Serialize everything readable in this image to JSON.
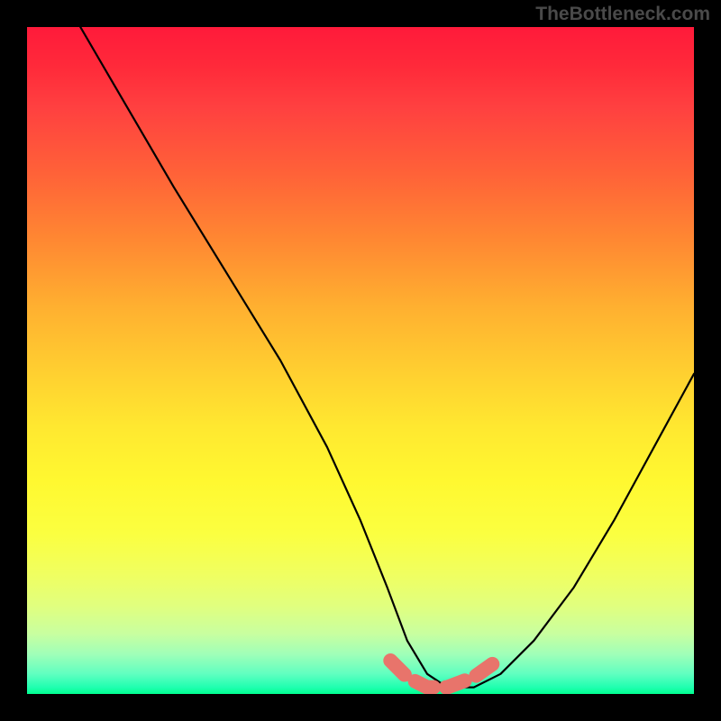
{
  "watermark": "TheBottleneck.com",
  "chart_data": {
    "type": "line",
    "title": "",
    "xlabel": "",
    "ylabel": "",
    "xlim": [
      0,
      100
    ],
    "ylim": [
      0,
      100
    ],
    "series": [
      {
        "name": "bottleneck-curve",
        "x": [
          8,
          15,
          22,
          30,
          38,
          45,
          50,
          54,
          57,
          60,
          63,
          67,
          71,
          76,
          82,
          88,
          94,
          100
        ],
        "values": [
          100,
          88,
          76,
          63,
          50,
          37,
          26,
          16,
          8,
          3,
          1,
          1,
          3,
          8,
          16,
          26,
          37,
          48
        ]
      }
    ],
    "highlight": {
      "name": "optimal-range",
      "x": [
        54.5,
        57,
        60,
        63,
        67,
        70.5
      ],
      "values": [
        5,
        2.5,
        1,
        1,
        2.5,
        5
      ]
    },
    "gradient_stops": [
      {
        "pos": 0,
        "color": "#ff1a3a"
      },
      {
        "pos": 50,
        "color": "#ffd030"
      },
      {
        "pos": 100,
        "color": "#00ff90"
      }
    ]
  }
}
